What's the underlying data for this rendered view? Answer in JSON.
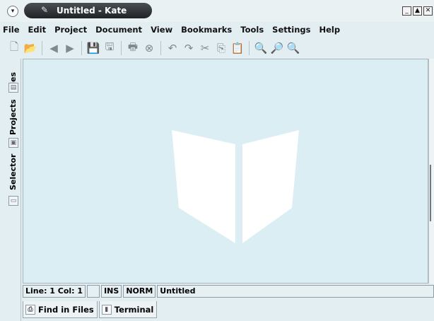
{
  "window": {
    "title": "Untitled - Kate",
    "sys_menu_icon": "▾",
    "app_icon": "kate-icon",
    "controls": [
      "_",
      "▲",
      "✕"
    ]
  },
  "menubar": {
    "items": [
      {
        "label": "File"
      },
      {
        "label": "Edit"
      },
      {
        "label": "Project"
      },
      {
        "label": "Document"
      },
      {
        "label": "View"
      },
      {
        "label": "Bookmarks"
      },
      {
        "label": "Tools"
      },
      {
        "label": "Settings"
      },
      {
        "label": "Help"
      }
    ]
  },
  "toolbar": {
    "buttons": [
      {
        "name": "new-document-icon",
        "glyph": "🗋"
      },
      {
        "name": "open-folder-icon",
        "glyph": "📂"
      },
      {
        "name": "back-icon",
        "glyph": "◀"
      },
      {
        "name": "forward-icon",
        "glyph": "▶"
      },
      {
        "name": "save-icon",
        "glyph": "💾"
      },
      {
        "name": "save-as-icon",
        "glyph": "🖫"
      },
      {
        "name": "print-icon",
        "glyph": "🖶"
      },
      {
        "name": "close-document-icon",
        "glyph": "⊗"
      },
      {
        "name": "undo-icon",
        "glyph": "↶"
      },
      {
        "name": "redo-icon",
        "glyph": "↷"
      },
      {
        "name": "cut-icon",
        "glyph": "✂"
      },
      {
        "name": "copy-icon",
        "glyph": "⎘"
      },
      {
        "name": "paste-icon",
        "glyph": "📋"
      },
      {
        "name": "find-icon",
        "glyph": "🔍"
      },
      {
        "name": "find-next-icon",
        "glyph": "🔎"
      },
      {
        "name": "zoom-icon",
        "glyph": "🔍"
      }
    ]
  },
  "sidetabs": {
    "files": "Files",
    "projects": "Projects",
    "selector": "Selector"
  },
  "status": {
    "line_col": "Line: 1 Col: 1",
    "ins": "INS",
    "norm": "NORM",
    "doc_name": "Untitled"
  },
  "bottom_tabs": {
    "find_in_files": "Find in Files",
    "terminal": "Terminal"
  },
  "colors": {
    "editor_bg": "#dbeef3",
    "window_bg": "#e3eef2",
    "watermark": "#c96a74"
  }
}
